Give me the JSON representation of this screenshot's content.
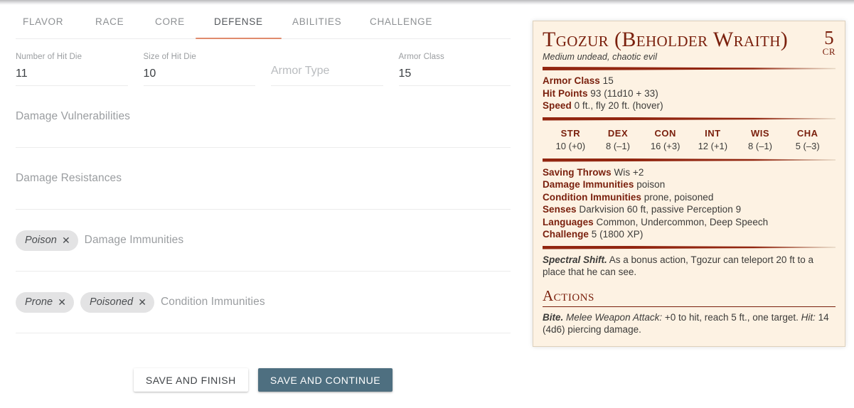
{
  "tabs": [
    {
      "label": "FLAVOR",
      "active": false
    },
    {
      "label": "RACE",
      "active": false
    },
    {
      "label": "CORE",
      "active": false
    },
    {
      "label": "DEFENSE",
      "active": true
    },
    {
      "label": "ABILITIES",
      "active": false
    },
    {
      "label": "CHALLENGE",
      "active": false
    }
  ],
  "accent_color": "#e08b6d",
  "primary_button_color": "#4e6f80",
  "statblock_bg_color": "#fdf2e3",
  "statblock_accent_color": "#7a200d",
  "form": {
    "fields": [
      {
        "label": "Number of Hit Die",
        "value": "11",
        "placeholder": "Number of Hit Die"
      },
      {
        "label": "Size of Hit Die",
        "value": "10",
        "placeholder": "Size of Hit Die"
      },
      {
        "label": "",
        "value": "",
        "placeholder": "Armor Type"
      },
      {
        "label": "Armor Class",
        "value": "15",
        "placeholder": "Armor Class"
      }
    ],
    "tag_fields": [
      {
        "placeholder": "Damage Vulnerabilities",
        "chips": []
      },
      {
        "placeholder": "Damage Resistances",
        "chips": []
      },
      {
        "placeholder": "Damage Immunities",
        "chips": [
          "Poison"
        ]
      },
      {
        "placeholder": "Condition Immunities",
        "chips": [
          "Prone",
          "Poisoned"
        ]
      }
    ],
    "chip_remove_glyph": "✕",
    "buttons": {
      "secondary": "SAVE AND FINISH",
      "primary": "SAVE AND CONTINUE"
    }
  },
  "statblock": {
    "name": "Tgozur (Beholder Wraith)",
    "meta": "Medium undead, chaotic evil",
    "cr_value": "5",
    "cr_label": "CR",
    "core": [
      {
        "label": "Armor Class",
        "value": "15"
      },
      {
        "label": "Hit Points",
        "value": "93 (11d10 + 33)"
      },
      {
        "label": "Speed",
        "value": "0 ft., fly 20 ft. (hover)"
      }
    ],
    "abilities": [
      {
        "name": "STR",
        "value": "10 (+0)"
      },
      {
        "name": "DEX",
        "value": "8 (–1)"
      },
      {
        "name": "CON",
        "value": "16 (+3)"
      },
      {
        "name": "INT",
        "value": "12 (+1)"
      },
      {
        "name": "WIS",
        "value": "8 (–1)"
      },
      {
        "name": "CHA",
        "value": "5 (–3)"
      }
    ],
    "traits": [
      {
        "label": "Saving Throws",
        "value": "Wis +2"
      },
      {
        "label": "Damage Immunities",
        "value": "poison"
      },
      {
        "label": "Condition Immunities",
        "value": "prone, poisoned"
      },
      {
        "label": "Senses",
        "value": "Darkvision 60 ft, passive Perception 9"
      },
      {
        "label": "Languages",
        "value": "Common, Undercommon, Deep Speech"
      },
      {
        "label": "Challenge",
        "value": "5 (1800 XP)"
      }
    ],
    "features": [
      {
        "name": "Spectral Shift.",
        "text": "As a bonus action, Tgozur can teleport 20 ft to a place that he can see."
      }
    ],
    "actions_title": "Actions",
    "actions": [
      {
        "name": "Bite.",
        "italic_lead": "Melee Weapon Attack:",
        "text_mid": " +0 to hit, reach 5 ft., one target. ",
        "italic_hit": "Hit:",
        "text_tail": " 14 (4d6) piercing damage."
      }
    ]
  }
}
